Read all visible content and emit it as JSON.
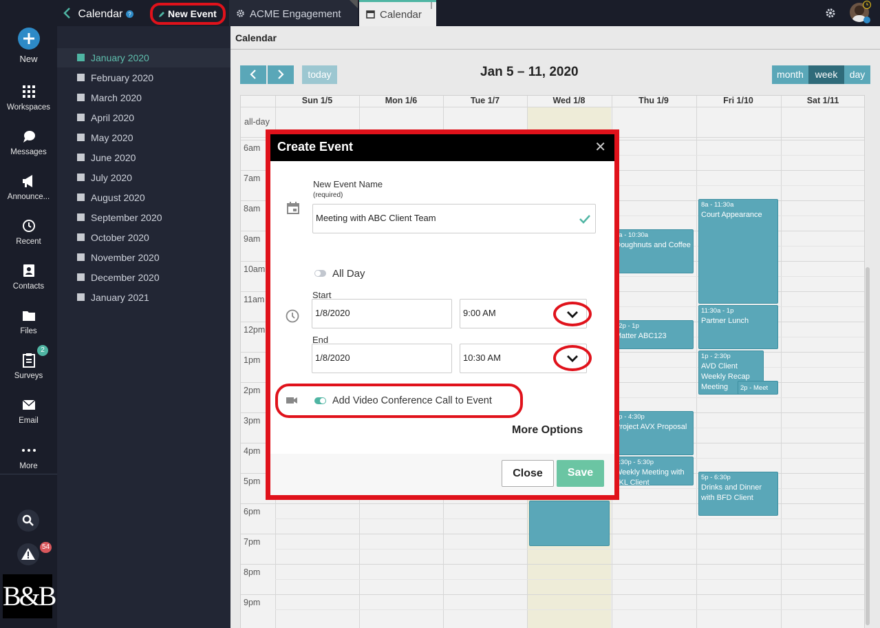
{
  "rail": {
    "new_label": "New",
    "items": [
      {
        "label": "Workspaces",
        "icon": "grid-icon"
      },
      {
        "label": "Messages",
        "icon": "chat-icon"
      },
      {
        "label": "Announce...",
        "icon": "megaphone-icon"
      },
      {
        "label": "Recent",
        "icon": "history-icon"
      },
      {
        "label": "Contacts",
        "icon": "contacts-icon"
      },
      {
        "label": "Files",
        "icon": "folder-icon"
      },
      {
        "label": "Surveys",
        "icon": "clipboard-icon"
      },
      {
        "label": "Email",
        "icon": "envelope-icon"
      },
      {
        "label": "More",
        "icon": "dots-icon"
      }
    ],
    "surveys_badge": "2",
    "alerts_badge": "54",
    "logo_text": "B&B"
  },
  "sidebar": {
    "title": "Calendar",
    "months": [
      "January 2020",
      "February 2020",
      "March 2020",
      "April 2020",
      "May 2020",
      "June 2020",
      "July 2020",
      "August 2020",
      "September 2020",
      "October 2020",
      "November 2020",
      "December 2020",
      "January 2021"
    ]
  },
  "tabs": {
    "new_event": "New Event",
    "acme": "ACME Engagement",
    "calendar": "Calendar"
  },
  "calendar": {
    "header": "Calendar",
    "today_label": "today",
    "range_title": "Jan 5 – 11, 2020",
    "views": [
      "month",
      "week",
      "day"
    ],
    "days": [
      "Sun 1/5",
      "Mon 1/6",
      "Tue 1/7",
      "Wed 1/8",
      "Thu 1/9",
      "Fri 1/10",
      "Sat 1/11"
    ],
    "allday_label": "all-day",
    "hours": [
      "6am",
      "7am",
      "8am",
      "9am",
      "10am",
      "11am",
      "12pm",
      "1pm",
      "2pm",
      "3pm",
      "4pm",
      "5pm",
      "6pm",
      "7pm",
      "8pm",
      "9pm"
    ],
    "events": [
      {
        "time": "8a - 11:30a",
        "title": "Court Appearance"
      },
      {
        "time": "9a - 10:30a",
        "title": "Doughnuts and Coffee"
      },
      {
        "time": "11:30a - 1p",
        "title": "Partner Lunch"
      },
      {
        "time": "12p - 1p",
        "title": "Matter ABC123"
      },
      {
        "time": "1p - 2:30p",
        "title": "AVD Client Weekly Recap Meeting"
      },
      {
        "time": "",
        "title": "2p - Meet"
      },
      {
        "time": "3p - 4:30p",
        "title": "Project AVX Proposal"
      },
      {
        "time": "4:30p - 5:30p",
        "title": "Weekly Meeting with JKL Client"
      },
      {
        "time": "5p - 6:30p",
        "title": "Drinks and Dinner with BFD Client"
      }
    ]
  },
  "modal": {
    "title": "Create Event",
    "name_label": "New Event Name",
    "name_hint": "(required)",
    "name_value": "Meeting with ABC Client Team",
    "allday_label": "All Day",
    "start_label": "Start",
    "start_date": "1/8/2020",
    "start_time": "9:00 AM",
    "end_label": "End",
    "end_date": "1/8/2020",
    "end_time": "10:30 AM",
    "video_label": "Add Video Conference Call to Event",
    "more_options": "More Options",
    "close_label": "Close",
    "save_label": "Save"
  },
  "colors": {
    "accent": "#4fb5a3",
    "highlight": "#e0121b",
    "event": "#5aa7b8"
  }
}
